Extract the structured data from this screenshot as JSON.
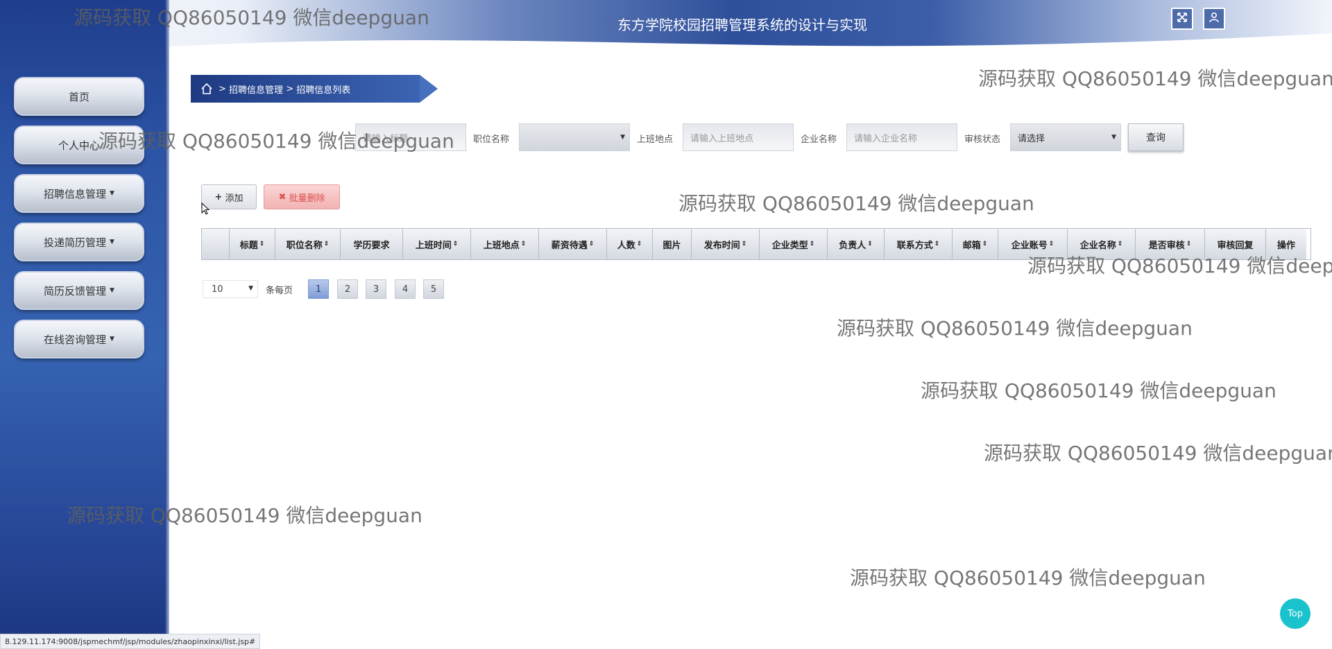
{
  "header": {
    "title": "东方学院校园招聘管理系统的设计与实现",
    "icons": [
      "fullscreen-icon",
      "user-icon"
    ]
  },
  "sidebar": {
    "items": [
      {
        "label": "首页",
        "has_caret": false
      },
      {
        "label": "个人中心",
        "has_caret": false
      },
      {
        "label": "招聘信息管理",
        "has_caret": true
      },
      {
        "label": "投递简历管理",
        "has_caret": true
      },
      {
        "label": "简历反馈管理",
        "has_caret": true
      },
      {
        "label": "在线咨询管理",
        "has_caret": true
      }
    ]
  },
  "breadcrumb": {
    "separator": ">",
    "level1": "招聘信息管理",
    "level2": "招聘信息列表"
  },
  "filters": {
    "title_placeholder": "请输入标题",
    "position_label": "职位名称",
    "position_value": "",
    "location_label": "上班地点",
    "location_placeholder": "请输入上班地点",
    "company_label": "企业名称",
    "company_placeholder": "请输入企业名称",
    "status_label": "审核状态",
    "status_value": "请选择",
    "search_label": "查询"
  },
  "actions": {
    "add_label": "添加",
    "delete_label": "批量删除"
  },
  "table": {
    "columns": [
      {
        "label": "",
        "sortable": false
      },
      {
        "label": "标题",
        "sortable": true
      },
      {
        "label": "职位名称",
        "sortable": true
      },
      {
        "label": "学历要求",
        "sortable": false
      },
      {
        "label": "上班时间",
        "sortable": true
      },
      {
        "label": "上班地点",
        "sortable": true
      },
      {
        "label": "薪资待遇",
        "sortable": true
      },
      {
        "label": "人数",
        "sortable": true
      },
      {
        "label": "图片",
        "sortable": false
      },
      {
        "label": "发布时间",
        "sortable": true
      },
      {
        "label": "企业类型",
        "sortable": true
      },
      {
        "label": "负责人",
        "sortable": true
      },
      {
        "label": "联系方式",
        "sortable": true
      },
      {
        "label": "邮箱",
        "sortable": true
      },
      {
        "label": "企业账号",
        "sortable": true
      },
      {
        "label": "企业名称",
        "sortable": true
      },
      {
        "label": "是否审核",
        "sortable": true
      },
      {
        "label": "审核回复",
        "sortable": false
      },
      {
        "label": "操作",
        "sortable": false
      }
    ],
    "rows": []
  },
  "pagination": {
    "page_size": "10",
    "page_size_label": "条每页",
    "pages": [
      "1",
      "2",
      "3",
      "4",
      "5"
    ],
    "current": "1"
  },
  "watermark": "源码获取 QQ86050149 微信deepguan",
  "statusbar": {
    "url": "8.129.11.174:9008/jspmechmf/jsp/modules/zhaopinxinxi/list.jsp#"
  },
  "top_button": "Top",
  "colors": {
    "sidebar": "#2d55a6",
    "accent": "#1e3a82",
    "danger": "#d9534f",
    "top_button": "#19c2cc"
  }
}
